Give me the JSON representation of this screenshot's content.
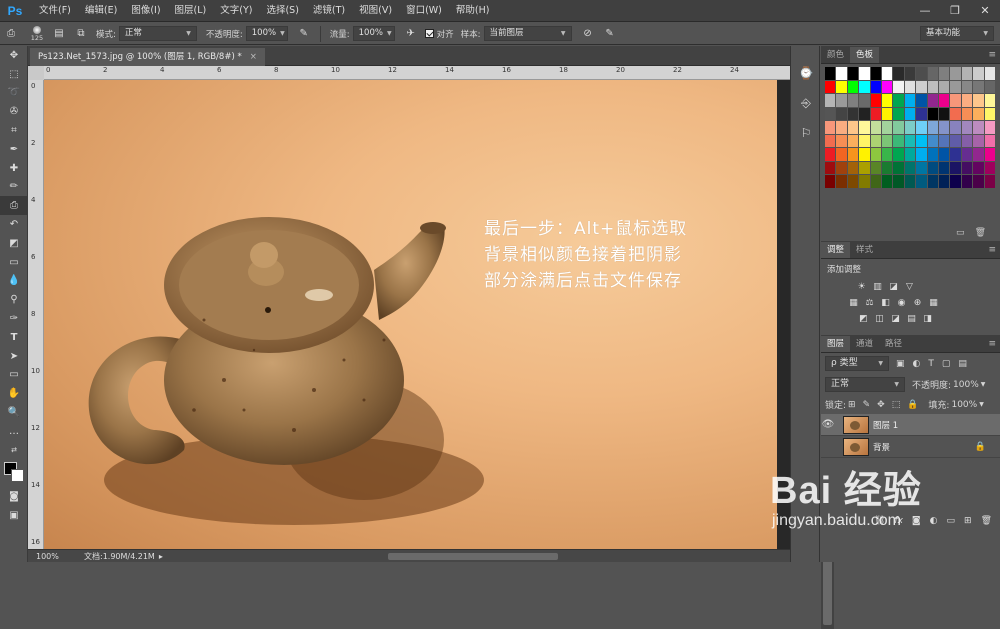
{
  "app": {
    "logo": "Ps"
  },
  "menu": [
    "文件(F)",
    "编辑(E)",
    "图像(I)",
    "图层(L)",
    "文字(Y)",
    "选择(S)",
    "滤镜(T)",
    "视图(V)",
    "窗口(W)",
    "帮助(H)"
  ],
  "window_controls": {
    "minimize": "—",
    "restore": "❐",
    "close": "✕"
  },
  "options": {
    "brush_size": "125",
    "mode_label": "模式:",
    "mode_value": "正常",
    "opacity_label": "不透明度:",
    "opacity_value": "100%",
    "flow_label": "流量:",
    "flow_value": "100%",
    "align_label": "对齐",
    "sample_label": "样本:",
    "sample_value": "当前图层",
    "workspace": "基本功能"
  },
  "document": {
    "tab_title": "Ps123.Net_1573.jpg @ 100% (图层 1, RGB/8#) *",
    "tab_close": "×",
    "overlay_lines": [
      "最后一步：Alt+鼠标选取",
      "背景相似颜色接着把阴影",
      "部分涂满后点击文件保存"
    ],
    "ruler_top_ticks": [
      "0",
      "2",
      "4",
      "6",
      "8",
      "10",
      "12",
      "14",
      "16",
      "18",
      "20",
      "22",
      "24"
    ],
    "ruler_left_ticks": [
      "0",
      "2",
      "4",
      "6",
      "8",
      "10",
      "12",
      "14",
      "16"
    ]
  },
  "status": {
    "zoom": "100%",
    "doc_info": "文档:1.90M/4.21M",
    "arrow": "▸"
  },
  "color_panel": {
    "tabs": [
      "颜色",
      "色板"
    ],
    "active": 1,
    "swatch_rows": [
      [
        "#000000",
        "#ffffff",
        "#000000",
        "#ffffff",
        "#000000",
        "#ffffff",
        "#2a2a2a",
        "#3a3a3a",
        "#4d4d4d",
        "#666666",
        "#7f7f7f",
        "#999999",
        "#b3b3b3",
        "#cccccc",
        "#e5e5e5"
      ],
      [
        "#ff0000",
        "#ffff00",
        "#00ff00",
        "#00ffff",
        "#0000ff",
        "#ff00ff",
        "#f2f2f2",
        "#e0e0e0",
        "#cfcfcf",
        "#bdbdbd",
        "#ababab",
        "#999999",
        "#888888",
        "#777777",
        "#666666"
      ],
      [
        "#b5b5b5",
        "#9a9a9a",
        "#7f7f7f",
        "#6a6a6a",
        "#ff0000",
        "#ffff00",
        "#00a651",
        "#00aeef",
        "#0054a6",
        "#92278f",
        "#ec008c",
        "#f7977a",
        "#fbad82",
        "#fdc68c",
        "#fff799"
      ],
      [
        "#555555",
        "#444444",
        "#333333",
        "#222222",
        "#ed1c24",
        "#fff200",
        "#00a650",
        "#00aeef",
        "#2e3192",
        "#000000",
        "#111111",
        "#f26c4f",
        "#f68e56",
        "#fbaf5c",
        "#fff568"
      ],
      [
        "#f7977a",
        "#f9ad81",
        "#fdc68a",
        "#fff79a",
        "#c4df9b",
        "#a3d39c",
        "#82ca9d",
        "#7bcdc8",
        "#6ecff6",
        "#7ea7d8",
        "#8493ca",
        "#8882be",
        "#a187be",
        "#bc8cbf",
        "#f49ac2"
      ],
      [
        "#f26c4f",
        "#f68e55",
        "#fbaf5d",
        "#fff467",
        "#acd372",
        "#7cc576",
        "#3bb878",
        "#1abbb4",
        "#00bff3",
        "#438ccb",
        "#5574b9",
        "#605ca8",
        "#855fa8",
        "#a763a8",
        "#f06ea9"
      ],
      [
        "#ed1c24",
        "#f26522",
        "#f7941d",
        "#fff200",
        "#8dc73f",
        "#39b54a",
        "#00a651",
        "#00a99d",
        "#00aeef",
        "#0072bc",
        "#0054a6",
        "#2e3192",
        "#662d91",
        "#92278f",
        "#ec008c"
      ],
      [
        "#9e0b0f",
        "#a0410d",
        "#a36209",
        "#aba000",
        "#598527",
        "#1a7b30",
        "#007236",
        "#00746b",
        "#0076a3",
        "#004b80",
        "#003471",
        "#1b1464",
        "#440e62",
        "#630460",
        "#9e005d"
      ],
      [
        "#790000",
        "#7b2e00",
        "#7d4900",
        "#827b00",
        "#406618",
        "#005e20",
        "#005826",
        "#005952",
        "#005b7f",
        "#003663",
        "#002157",
        "#0d004c",
        "#32004b",
        "#4b0049",
        "#7b0046"
      ]
    ],
    "footer_icons": [
      "folder-icon",
      "trash-icon"
    ]
  },
  "adjust_panel": {
    "tabs": [
      "调整",
      "样式"
    ],
    "add_label": "添加调整",
    "row1": [
      "☀",
      "▥",
      "◪",
      "▽"
    ],
    "row2": [
      "▦",
      "⚖",
      "◧",
      "◉",
      "⊕",
      "▦"
    ],
    "row3": [
      "◩",
      "◫",
      "◪",
      "▤",
      "◨"
    ]
  },
  "layers_panel": {
    "tabs": [
      "图层",
      "通道",
      "路径"
    ],
    "filter_label": "ρ 类型",
    "blend": "正常",
    "opacity_label": "不透明度:",
    "opacity": "100%",
    "lock_label": "锁定:",
    "fill_label": "填充:",
    "fill": "100%",
    "layers": [
      {
        "name": "图层 1",
        "visible": true,
        "selected": true
      },
      {
        "name": "背景",
        "visible": false,
        "locked": true
      }
    ],
    "bottom_icons": [
      "link-icon",
      "fx-icon",
      "mask-icon",
      "adjust-icon",
      "group-icon",
      "new-layer-icon",
      "trash-icon"
    ]
  },
  "watermark": {
    "logo": "Bai  经验",
    "url": "jingyan.baidu.com"
  }
}
